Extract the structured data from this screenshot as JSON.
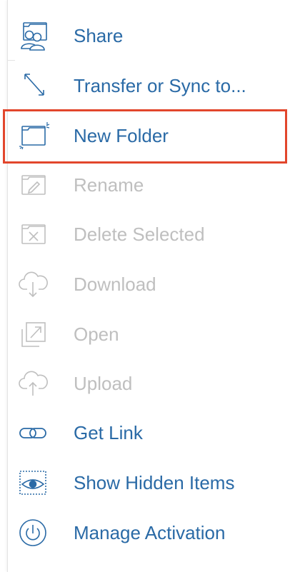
{
  "colors": {
    "enabled": "#2a6aa6",
    "disabled": "#bfbfbf",
    "highlight": "#e2462c"
  },
  "menu": {
    "items": [
      {
        "label": "Share",
        "icon": "share-users-icon",
        "enabled": true
      },
      {
        "label": "Transfer or Sync to...",
        "icon": "transfer-arrow-icon",
        "enabled": true
      },
      {
        "label": "New Folder",
        "icon": "new-folder-icon",
        "enabled": true,
        "highlighted": true
      },
      {
        "label": "Rename",
        "icon": "rename-pencil-icon",
        "enabled": false
      },
      {
        "label": "Delete Selected",
        "icon": "delete-x-icon",
        "enabled": false
      },
      {
        "label": "Download",
        "icon": "cloud-download-icon",
        "enabled": false
      },
      {
        "label": "Open",
        "icon": "open-external-icon",
        "enabled": false
      },
      {
        "label": "Upload",
        "icon": "cloud-upload-icon",
        "enabled": false
      },
      {
        "label": "Get Link",
        "icon": "link-chain-icon",
        "enabled": true
      },
      {
        "label": "Show Hidden Items",
        "icon": "eye-icon",
        "enabled": true
      },
      {
        "label": "Manage Activation",
        "icon": "power-icon",
        "enabled": true
      }
    ]
  }
}
